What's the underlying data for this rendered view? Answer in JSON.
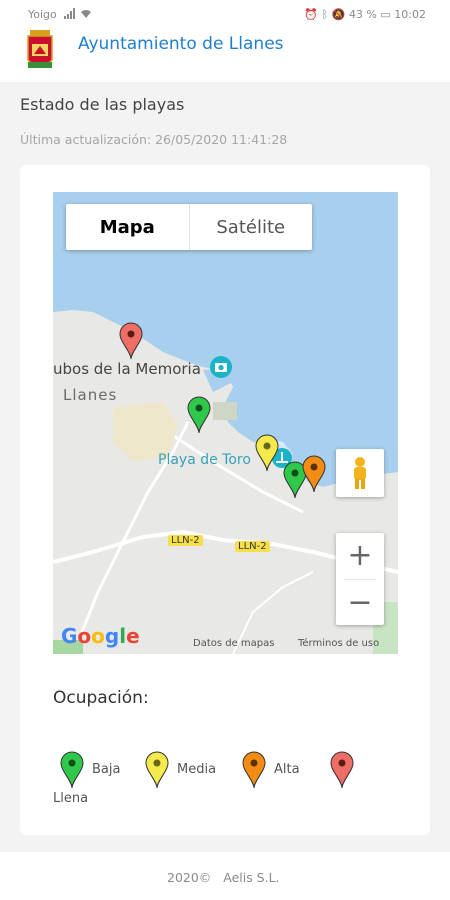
{
  "status_bar": {
    "carrier": "Yoigo",
    "battery": "43 %",
    "time": "10:02"
  },
  "header": {
    "title": "Ayuntamiento de Llanes"
  },
  "section": {
    "title": "Estado de las playas",
    "updated": "Última actualización: 26/05/2020 11:41:28"
  },
  "map": {
    "type_selected": "Mapa",
    "type_other": "Satélite",
    "labels": {
      "memoria": "ubos de la Memoria",
      "town": "Llanes",
      "beach": "Playa de Toro",
      "road1": "LLN-2",
      "road2": "LLN-2"
    },
    "zoom_in": "+",
    "zoom_out": "−",
    "attribution_data": "Datos de mapas",
    "attribution_terms": "Términos de uso",
    "logo": "Google",
    "markers": [
      {
        "status": "Llena",
        "color": "#ee6e66"
      },
      {
        "status": "Baja",
        "color": "#2fc84b"
      },
      {
        "status": "Media",
        "color": "#f4ea4c"
      },
      {
        "status": "Baja",
        "color": "#2fc84b"
      },
      {
        "status": "Alta",
        "color": "#f28c12"
      }
    ]
  },
  "occupancy": {
    "title": "Ocupación:",
    "levels": [
      {
        "label": "Baja",
        "color": "#2fc84b"
      },
      {
        "label": "Media",
        "color": "#f4ea4c"
      },
      {
        "label": "Alta",
        "color": "#f28c12"
      },
      {
        "label": "Llena",
        "color": "#ee6e66"
      }
    ]
  },
  "footer": {
    "text": "2020©   Aelis S.L."
  }
}
